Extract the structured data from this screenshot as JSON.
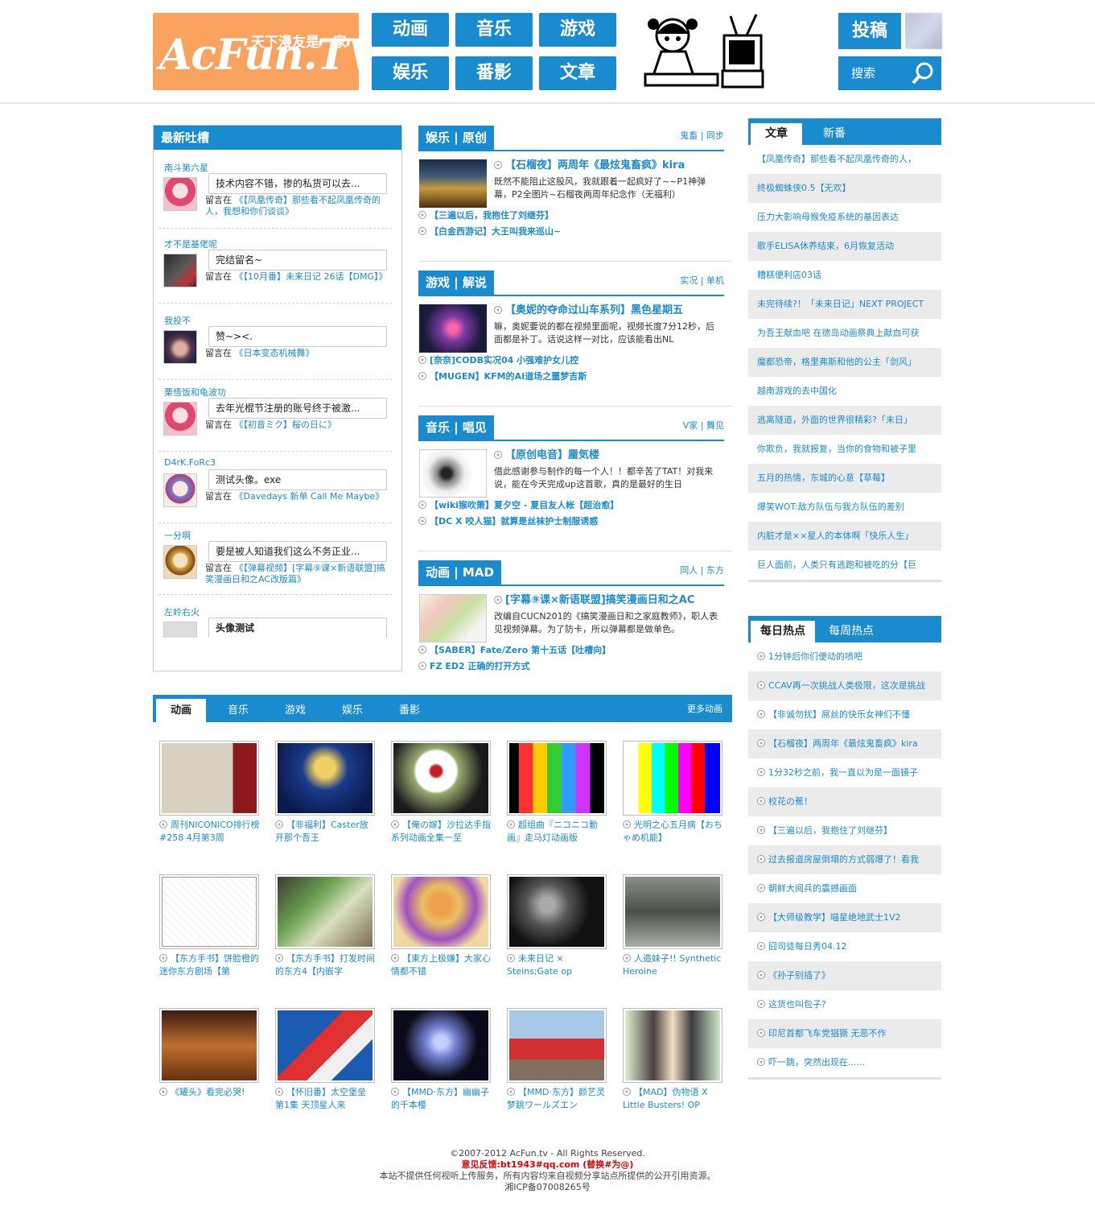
{
  "logo": {
    "text": "AcFun.TV",
    "tagline": "天下漫友是一家"
  },
  "nav": [
    {
      "label": "动画"
    },
    {
      "label": "音乐"
    },
    {
      "label": "游戏"
    },
    {
      "label": "娱乐"
    },
    {
      "label": "番影"
    },
    {
      "label": "文章"
    }
  ],
  "header": {
    "submit_label": "投稿",
    "search_placeholder": "搜索"
  },
  "latest_comments": {
    "title": "最新吐槽",
    "items": [
      {
        "user": "南斗第六星",
        "text": "技术内容不错，掺的私货可以去...",
        "on_prefix": "留言在",
        "target": "《【凤凰传奇】那些看不起凤凰传奇的人，我想和你们谈谈》"
      },
      {
        "user": "才不是基佬呢",
        "text": "完结留名~",
        "on_prefix": "留言在",
        "target": "《【10月番】未来日记 26话【DMG】》"
      },
      {
        "user": "我投不",
        "text": "赞~><.",
        "on_prefix": "留言在",
        "target": "《日本变态机械舞》"
      },
      {
        "user": "栗悟饭和龟波功",
        "text": "去年光棍节注册的账号终于被激...",
        "on_prefix": "留言在",
        "target": "《【初音ミク】桜の日に》"
      },
      {
        "user": "D4rK.FoRc3",
        "text": "测试头像。exe",
        "on_prefix": "留言在",
        "target": "《Davedays 新单 Call Me Maybe》"
      },
      {
        "user": "一分啊",
        "text": "要是被人知道我们这么不务正业...",
        "on_prefix": "留言在",
        "target": "《【弹幕视频】[字幕⑨课×新语联盟]搞笑漫画日和之AC改版篇》"
      },
      {
        "user": "左岭右火",
        "text": "头像测试",
        "on_prefix": "",
        "target": ""
      }
    ]
  },
  "sections": [
    {
      "tab": "娱乐 | 原创",
      "sub": "鬼畜 | 同步",
      "title": "【石榴夜】两周年《最炫鬼畜疯》kira",
      "desc": "既然不能阻止这股风，我就跟着一起疯好了~~P1神弹幕，P2全图片~石榴夜两周年纪念作（无福利）",
      "links": [
        "【三遍以后，我抱住了刘继芬】",
        "【白金西游记】大王叫我来巡山~"
      ]
    },
    {
      "tab": "游戏 | 解说",
      "sub": "实况 | 单机",
      "title": "【奥妮的夺命过山车系列】黑色星期五",
      "desc": "嘛，奥妮要说的都在视频里面呢，视频长度7分12秒，后面都是补丁。话说这样一对比，应该能看出NL",
      "links": [
        "[奈奈]CODB实况04 小强难护女儿控",
        "【MUGEN】KFM的AI道场之噩梦吉斯"
      ]
    },
    {
      "tab": "音乐 | 唱见",
      "sub": "V家 | 舞见",
      "title": "【原创电音】蜃気楼",
      "desc": "借此感谢参与制作的每一个人！！都辛苦了TAT！对我来说，能在今天完成up这首歌，真的是最好的生日",
      "links": [
        "【wiki猴吹箫】夏夕空 - 夏目友人帐【超治愈】",
        "【DC X 咬人猫】就算是丝袜护士制服诱惑"
      ]
    },
    {
      "tab": "动画 | MAD",
      "sub": "同人 | 东方",
      "title": "[字幕⑨课×新语联盟]搞笑漫画日和之AC",
      "desc": "改编自CUCN201的《搞笑漫画日和之家庭教师》，职人表见视频弹幕。为了防卡，所以弹幕都是做单色。",
      "links": [
        "【SABER】Fate/Zero 第十五话【吐槽向】",
        "FZ ED2 正确的打开方式"
      ]
    }
  ],
  "articles": {
    "tabs": [
      "文章",
      "新番"
    ],
    "items": [
      "【凤凰传奇】那些看不起凤凰传奇的人，",
      "终极蜘蛛侠0.5【无欢】",
      "压力大影响母猴免疫系统的基因表达",
      "歌手ELISA休养结束，6月恢复活动",
      "糟糕便利店03话",
      "未完待续?！「未来日记」NEXT PROJECT",
      "为吾王献血吧 在德岛动画祭典上献血可获",
      "魔都恐帝，格里弗斯和他的公主「剑风」",
      "越南游戏的去中国化",
      "逃离隧道，外面的世界很精彩?「末日」",
      "你欺负，我就报复，当你的食物和被子里",
      "五月的热情，东城的心意【草莓】",
      "爆笑WOT:敌方队伍与我方队伍的差别",
      "内脏才是××星人的本体啊「快乐人生」",
      "巨人面前，人类只有逃跑和被吃的分【巨"
    ]
  },
  "hot": {
    "tabs": [
      "每日热点",
      "每周热点"
    ],
    "items": [
      "1分钟后你们便动的喷吧",
      "CCAV再一次挑战人类极限，这次是挑战",
      "【非诚勿扰】屌丝的快乐女神们不懂",
      "【石榴夜】两周年《最炫鬼畜疯》kira",
      "1分32秒之前，我一直以为是一面镜子",
      "校花の蕉！",
      "【三遍以后，我抱住了刘继芬】",
      "过去报道房屋倒塌的方式弱爆了！看我",
      "朝鲜大阅兵的震撼画面",
      "【大师级教学】喵星绝地武士1V2",
      "囧司徒每日秀04.12",
      "《孙子别插了》",
      "这货也叫包子?",
      "印尼首都飞车党猖獗 无恶不作",
      "吓一跳，突然出现在......"
    ]
  },
  "bottom": {
    "tabs": [
      "动画",
      "音乐",
      "游戏",
      "娱乐",
      "番影"
    ],
    "more": "更多动画",
    "grid": [
      "周刊NICONICO排行榜 #258 4月第3周",
      "【非福利】Caster放开那个吾王",
      "【俺の嫁】沙拉达手指系列动画全集一至",
      "超组曲『ニコニコ動画』走马灯动画版",
      "光明之心五月病【おちゃめ机能】",
      "【东方手书】饼脸橙的迷你东方剧场【第",
      "【东方手书】打发时间的东方4【内嵌字",
      "【東方上极嫌】大家心情都不错",
      "未来日记 × Steins;Gate op",
      "人造妹子!! Synthetic Heroine",
      "《罐头》看完必哭!",
      "【怀旧番】太空堡垒 第1集 天顶星人来",
      "【MMD·东方】幽幽子的千本樱",
      "【MMD·东方】颜艺灵梦跳ワールズエン",
      "【MAD】伪物语 X Little Busters! OP"
    ]
  },
  "footer": {
    "copyright": "©2007-2012 AcFun.tv - All Rights Reserved.",
    "feedback": "意见反馈:bt1943#qq.com (替换#为@)",
    "disclaimer": "本站不提供任何视听上传服务，所有内容均来自视频分享站点所提供的公开引用资源。",
    "icp": "湘ICP备07008265号"
  },
  "colors": {
    "accent": "#1b8bd0",
    "logo_bg": "#f9a35e",
    "footer_highlight": "#e00000"
  }
}
